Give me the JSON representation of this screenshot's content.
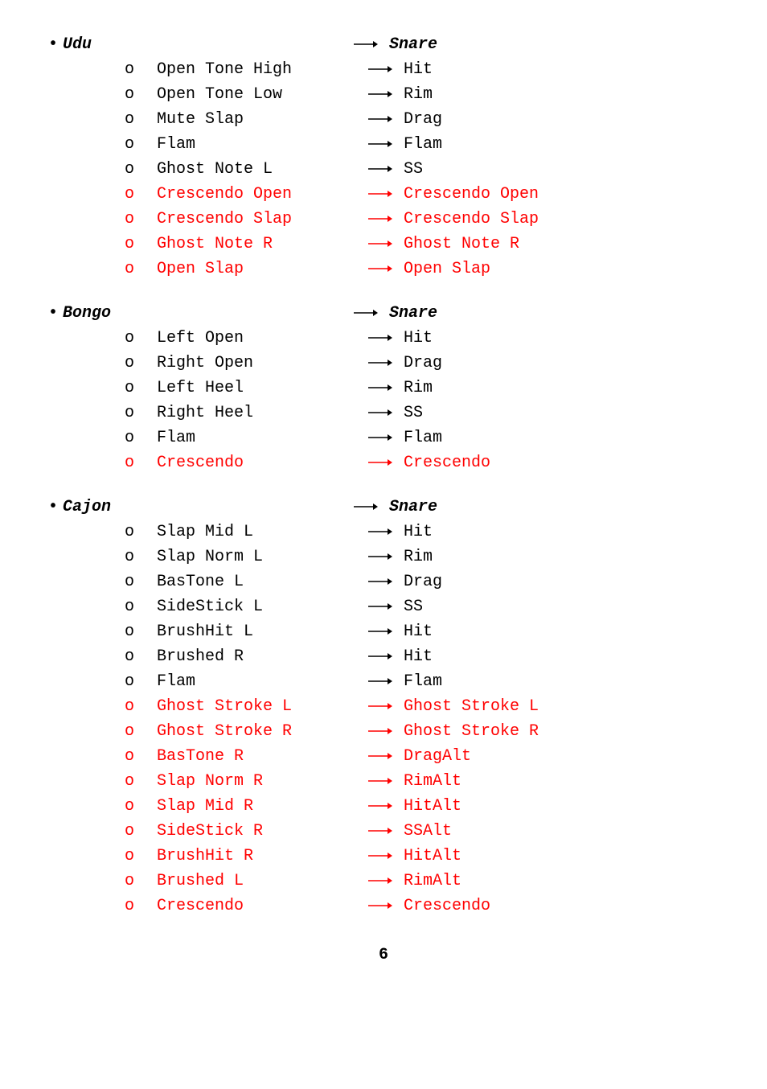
{
  "page_number": "6",
  "groups": [
    {
      "left_title": "Udu",
      "right_title": "Snare",
      "items": [
        {
          "left": "Open Tone High",
          "right": "Hit",
          "red": false
        },
        {
          "left": "Open Tone Low",
          "right": "Rim",
          "red": false
        },
        {
          "left": "Mute Slap",
          "right": "Drag",
          "red": false
        },
        {
          "left": "Flam",
          "right": "Flam",
          "red": false
        },
        {
          "left": "Ghost Note L",
          "right": " SS",
          "red": false
        },
        {
          "left": "Crescendo Open",
          "right": "Crescendo Open",
          "red": true
        },
        {
          "left": "Crescendo Slap",
          "right": "Crescendo Slap",
          "red": true
        },
        {
          "left": "Ghost Note R",
          "right": "Ghost Note R",
          "red": true
        },
        {
          "left": "Open Slap",
          "right": "Open Slap",
          "red": true
        }
      ]
    },
    {
      "left_title": "Bongo",
      "right_title": "Snare",
      "items": [
        {
          "left": "Left Open",
          "right": "Hit",
          "red": false
        },
        {
          "left": "Right Open",
          "right": "Drag",
          "red": false
        },
        {
          "left": "Left Heel",
          "right": " Rim",
          "red": false
        },
        {
          "left": "Right Heel",
          "right": "SS",
          "red": false
        },
        {
          "left": "Flam",
          "right": "Flam",
          "red": false
        },
        {
          "left": "Crescendo",
          "right": "Crescendo",
          "red": true
        }
      ]
    },
    {
      "left_title": "Cajon",
      "right_title": "Snare",
      "items": [
        {
          "left": "Slap Mid L",
          "right": "Hit",
          "red": false
        },
        {
          "left": "Slap Norm L",
          "right": "Rim",
          "red": false
        },
        {
          "left": "BasTone L",
          "right": "Drag",
          "red": false
        },
        {
          "left": "SideStick L",
          "right": "SS",
          "red": false
        },
        {
          "left": "BrushHit L",
          "right": "Hit",
          "red": false
        },
        {
          "left": "Brushed R",
          "right": "Hit",
          "red": false
        },
        {
          "left": "Flam",
          "right": "Flam",
          "red": false
        },
        {
          "left": "Ghost Stroke L",
          "right": "Ghost Stroke L",
          "red": true
        },
        {
          "left": "Ghost Stroke R",
          "right": "Ghost Stroke R",
          "red": true
        },
        {
          "left": "BasTone R",
          "right": "DragAlt",
          "red": true
        },
        {
          "left": "Slap Norm R",
          "right": "RimAlt",
          "red": true
        },
        {
          "left": "Slap Mid R",
          "right": "HitAlt",
          "red": true
        },
        {
          "left": "SideStick R",
          "right": "SSAlt",
          "red": true
        },
        {
          "left": "BrushHit R",
          "right": "HitAlt",
          "red": true
        },
        {
          "left": "Brushed L",
          "right": "RimAlt",
          "red": true
        },
        {
          "left": "Crescendo",
          "right": "Crescendo",
          "red": true
        }
      ]
    }
  ]
}
